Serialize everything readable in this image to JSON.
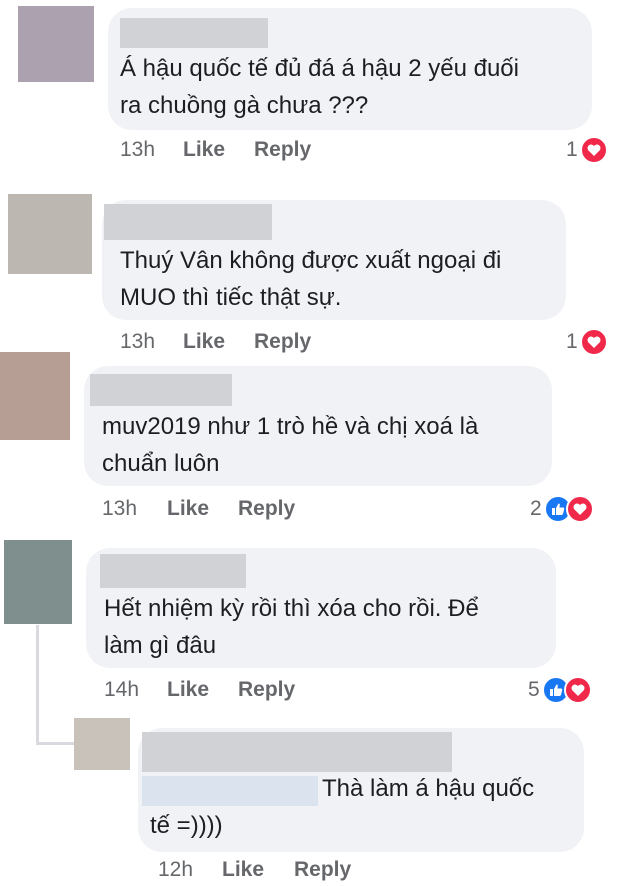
{
  "comments": [
    {
      "text": "Á hậu quốc tế đủ đá á hậu 2 yếu đuối\nra chuồng gà chưa ???",
      "time": "13h",
      "like": "Like",
      "reply": "Reply",
      "count": "1",
      "avatar_color": "#aca1ae"
    },
    {
      "text": "Thuý Vân không được xuất ngoại đi\nMUO thì tiếc thật sự.",
      "time": "13h",
      "like": "Like",
      "reply": "Reply",
      "count": "1",
      "avatar_color": "#bdb7b1"
    },
    {
      "text": "muv2019 như 1 trò hề và chị xoá là\nchuẩn luôn",
      "time": "13h",
      "like": "Like",
      "reply": "Reply",
      "count": "2",
      "avatar_color": "#b79e95"
    },
    {
      "text": "Hết nhiệm kỳ rồi thì xóa cho rồi. Để\nlàm gì đâu",
      "time": "14h",
      "like": "Like",
      "reply": "Reply",
      "count": "5",
      "avatar_color": "#7e8f8d"
    },
    {
      "text": "Thà làm á hậu quốc\ntế =))))",
      "time": "12h",
      "like": "Like",
      "reply": "Reply",
      "avatar_color": "#c8c2bb"
    }
  ],
  "colors": {
    "like_blue": "#1877f2",
    "love_red": "#f02849",
    "bubble": "#f0f2f5",
    "meta": "#65676b"
  },
  "icons": {
    "like": "thumbs-up-icon",
    "love": "heart-icon"
  }
}
